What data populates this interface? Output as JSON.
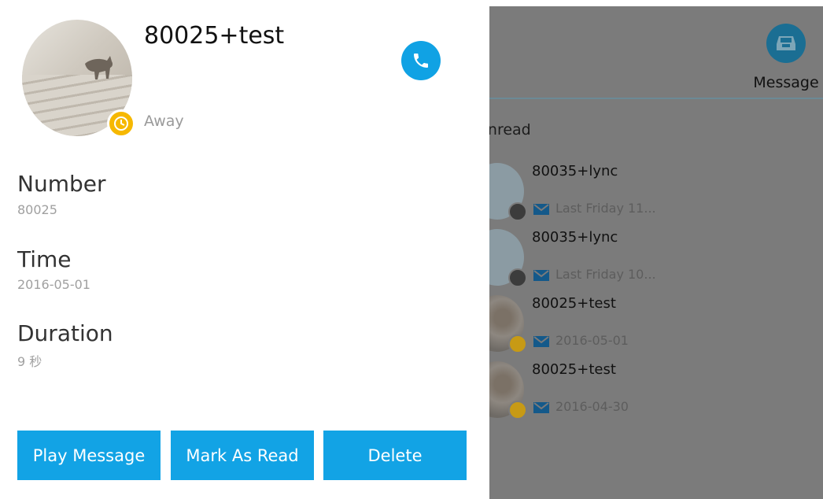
{
  "message_tab": {
    "label": "Message"
  },
  "list": {
    "section_title": "Unread",
    "items": [
      {
        "name": "80035+lync",
        "sub": "Last Friday 11...",
        "status": "offline"
      },
      {
        "name": "80035+lync",
        "sub": "Last Friday 10...",
        "status": "offline"
      },
      {
        "name": "80025+test",
        "sub": "2016-05-01",
        "status": "away"
      },
      {
        "name": "80025+test",
        "sub": "2016-04-30",
        "status": "away"
      }
    ]
  },
  "detail": {
    "name": "80025+test",
    "presence": "Away",
    "fields": [
      {
        "label": "Number",
        "value": "80025"
      },
      {
        "label": "Time",
        "value": "2016-05-01"
      },
      {
        "label": "Duration",
        "value": "9 秒"
      }
    ],
    "actions": {
      "play": "Play Message",
      "mark_read": "Mark As Read",
      "delete": "Delete"
    }
  },
  "colors": {
    "accent": "#12a3e5",
    "away": "#f6b800",
    "overlay": "#7b7b7b"
  }
}
